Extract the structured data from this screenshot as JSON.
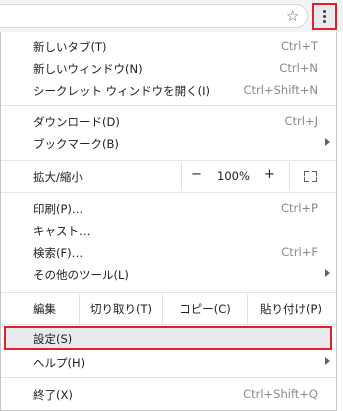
{
  "toolbar": {
    "star_icon": "star-outline-icon",
    "menu_icon": "three-dot-menu-icon"
  },
  "menu": {
    "new_tab": {
      "label": "新しいタブ(T)",
      "shortcut": "Ctrl+T"
    },
    "new_window": {
      "label": "新しいウィンドウ(N)",
      "shortcut": "Ctrl+N"
    },
    "incognito": {
      "label": "シークレット ウィンドウを開く(I)",
      "shortcut": "Ctrl+Shift+N"
    },
    "downloads": {
      "label": "ダウンロード(D)",
      "shortcut": "Ctrl+J"
    },
    "bookmarks": {
      "label": "ブックマーク(B)"
    },
    "zoom": {
      "label": "拡大/縮小",
      "minus": "−",
      "value": "100%",
      "plus": "+"
    },
    "print": {
      "label": "印刷(P)…",
      "shortcut": "Ctrl+P"
    },
    "cast": {
      "label": "キャスト…"
    },
    "find": {
      "label": "検索(F)…",
      "shortcut": "Ctrl+F"
    },
    "more_tools": {
      "label": "その他のツール(L)"
    },
    "edit": {
      "label": "編集",
      "cut": "切り取り(T)",
      "copy": "コピー(C)",
      "paste": "貼り付け(P)"
    },
    "settings": {
      "label": "設定(S)"
    },
    "help": {
      "label": "ヘルプ(H)"
    },
    "exit": {
      "label": "終了(X)",
      "shortcut": "Ctrl+Shift+Q"
    }
  },
  "colors": {
    "highlight_border": "#e0202a",
    "highlight_bg": "#e8eaed"
  }
}
